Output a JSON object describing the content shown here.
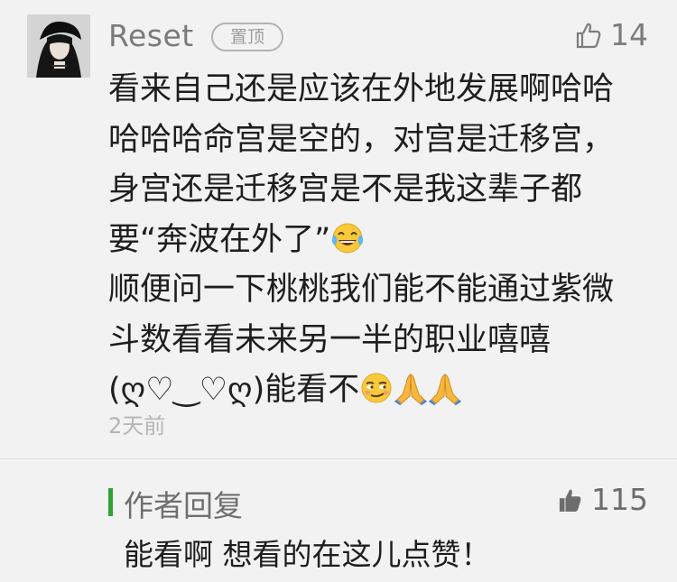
{
  "comment": {
    "username": "Reset",
    "pin_label": "置顶",
    "like_count": "14",
    "lines": [
      "看来自己还是应该在外地发展啊哈哈",
      "哈哈哈命宫是空的，对宫是迁移宫，",
      "身宫还是迁移宫是不是我这辈子都",
      "要“奔波在外了”",
      "顺便问一下桃桃我们能不能通过紫微",
      "斗数看看未来另一半的职业嘻嘻",
      "(ღ♡‿♡ღ)能看不"
    ],
    "time": "2天前"
  },
  "reply": {
    "title": "作者回复",
    "like_count": "115",
    "text": "能看啊 想看的在这儿点赞！"
  },
  "icons": {
    "avatar": "avatar-portrait",
    "like": "thumbs-up-icon",
    "emoji_laugh": "tears-of-joy-emoji",
    "emoji_smirk": "smirking-face-emoji",
    "emoji_pray": "folded-hands-emoji"
  },
  "colors": {
    "background": "#f2f2f2",
    "accent_bar": "#2ea233",
    "text": "#1e1e1e",
    "muted": "#7a7a7a"
  }
}
